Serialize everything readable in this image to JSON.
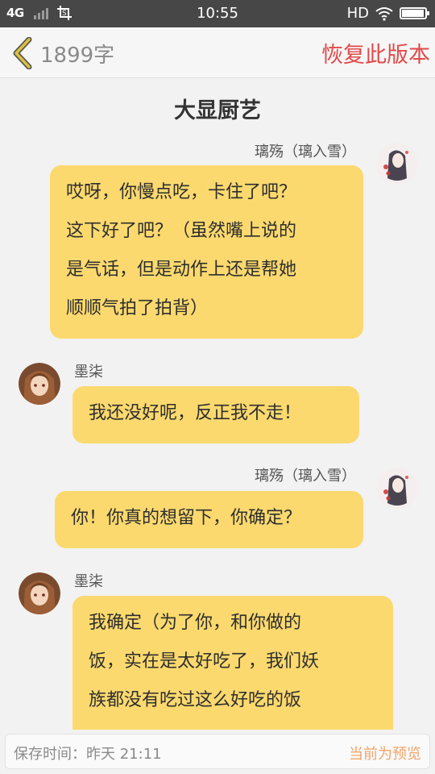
{
  "status_bar": {
    "network": "4G",
    "time": "10:55",
    "hd": "HD",
    "icons": [
      "signal-icon",
      "screenshot-icon",
      "wifi-icon",
      "battery-icon"
    ],
    "battery_level": 0.95
  },
  "header": {
    "back_icon": "chevron-left-icon",
    "word_count": "1899字",
    "restore_label": "恢复此版本"
  },
  "title": "大显厨艺",
  "messages": [
    {
      "side": "right",
      "name": "璃殇（璃入雪）",
      "lines": [
        "哎呀，你慢点吃，卡住了吧？",
        "这下好了吧？（虽然嘴上说的",
        "是气话，但是动作上还是帮她",
        "顺顺气拍了拍背）"
      ]
    },
    {
      "side": "left",
      "name": "墨柒",
      "lines": [
        "我还没好呢，反正我不走！"
      ]
    },
    {
      "side": "right",
      "name": "璃殇（璃入雪）",
      "lines": [
        "你！你真的想留下，你确定？"
      ]
    },
    {
      "side": "left",
      "name": "墨柒",
      "lines": [
        "我确定（为了你，和你做的",
        "饭，实在是太好吃了，我们妖",
        "族都没有吃过这么好吃的饭"
      ]
    }
  ],
  "footer": {
    "save_time": "保存时间：昨天 21:11",
    "preview_label": "当前为预览"
  },
  "colors": {
    "bubble": "#fbd96e",
    "accent_red": "#e24a4a",
    "preview_orange": "#f0a46a",
    "status_bar": "#474747",
    "back_arrow": "#c9b23a"
  }
}
